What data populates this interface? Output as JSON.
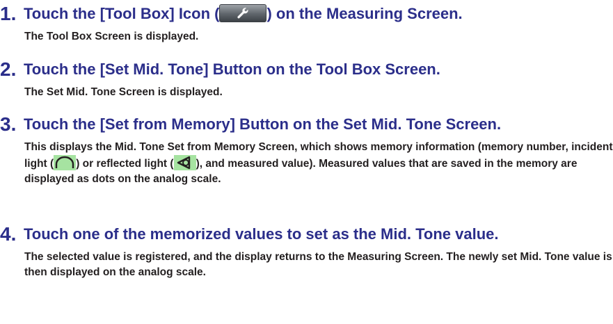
{
  "steps": [
    {
      "number": "1.",
      "heading_before": "Touch the [Tool Box] Icon (",
      "heading_after": ") on the Measuring Screen.",
      "description": "The Tool Box Screen is displayed."
    },
    {
      "number": "2.",
      "heading": "Touch the [Set Mid. Tone] Button on the Tool Box Screen.",
      "description": "The Set Mid. Tone Screen is displayed."
    },
    {
      "number": "3.",
      "heading": "Touch the [Set from Memory] Button on the Set Mid. Tone Screen.",
      "description_part1": "This displays the Mid. Tone Set from Memory Screen, which shows memory information (memory number, incident light (",
      "description_part2": ") or reflected light (",
      "description_part3": "), and measured value). Measured values that are saved in the memory are displayed as dots on the analog scale."
    },
    {
      "number": "4.",
      "heading": "Touch one of the memorized values to set as the Mid. Tone value.",
      "description": "The selected value is registered, and the display returns to the Measuring Screen. The newly set Mid. Tone value is then displayed on the analog scale."
    }
  ],
  "icons": {
    "tool_box": "wrench-icon",
    "incident_light": "incident-light-dome-icon",
    "reflected_light": "reflected-light-icon"
  },
  "colors": {
    "heading": "#2b2e8a",
    "body_text": "#231f20",
    "icon_highlight": "#a6e3a1"
  }
}
